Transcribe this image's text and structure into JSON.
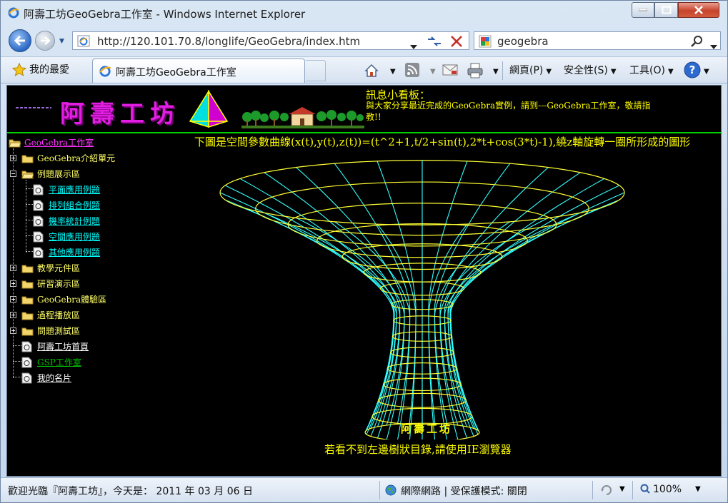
{
  "window": {
    "title": "阿壽工坊GeoGebra工作室 - Windows Internet Explorer"
  },
  "address_bar": {
    "url": "http://120.101.70.8/longlife/GeoGebra/index.htm"
  },
  "search_bar": {
    "value": "geogebra"
  },
  "favorites": {
    "label": "我的最愛",
    "tab_title": "阿壽工坊GeoGebra工作室"
  },
  "command_bar": {
    "page": "網頁(P)",
    "safety": "安全性(S)",
    "tools": "工具(O)"
  },
  "page": {
    "site_title": "阿壽工坊",
    "message_title": "訊息小看板：",
    "message_body": "與大家分享最近完成的GeoGebra實例，請到---GeoGebra工作室，敬請指教!!",
    "graph_heading": "下圖是空間參數曲線(x(t),y(t),z(t))=(t^2+1,t/2+sin(t),2*t+cos(3*t)-1),繞z軸旋轉一圈所形成的圖形",
    "graph_caption": "阿壽工坊",
    "graph_footer": "若看不到左邊樹狀目錄,請使用IE瀏覽器"
  },
  "tree": {
    "root": "GeoGebra工作室",
    "items": [
      "GeoGebra介紹單元",
      "例題展示區",
      "平面應用例題",
      "排列組合例題",
      "機率統計例題",
      "空間應用例題",
      "其他應用例題",
      "教學元件區",
      "研習演示區",
      "GeoGebra體驗區",
      "過程播放區",
      "問題測試區",
      "阿壽工坊首頁",
      "GSP工作室",
      "我的名片"
    ]
  },
  "status_bar": {
    "text": "歡迎光臨『阿壽工坊』，今天是： 2011 年 03 月 06 日",
    "zone": "網際網路 | 受保護模式: 關閉",
    "zoom": "100%"
  },
  "colors": {
    "page_background": "#000000",
    "surface_yellow": "#ffff33",
    "surface_cyan": "#33ffff",
    "divider_green": "#00d000",
    "title_magenta": "#e21ee2"
  }
}
